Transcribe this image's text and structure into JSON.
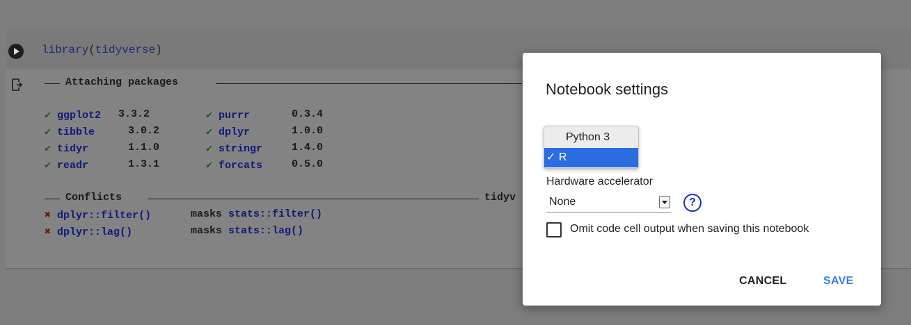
{
  "cell": {
    "code_fn": "library",
    "code_open": "(",
    "code_arg": "tidyverse",
    "code_close": ")"
  },
  "output": {
    "attaching_header": "Attaching packages",
    "packages_left": [
      {
        "check": "✔",
        "name": "ggplot2",
        "version": "3.3.2"
      },
      {
        "check": "✔",
        "name": "tibble",
        "version": "3.0.2"
      },
      {
        "check": "✔",
        "name": "tidyr",
        "version": "1.1.0"
      },
      {
        "check": "✔",
        "name": "readr",
        "version": "1.3.1"
      }
    ],
    "packages_right": [
      {
        "check": "✔",
        "name": "purrr",
        "version": "0.3.4"
      },
      {
        "check": "✔",
        "name": "dplyr",
        "version": "1.0.0"
      },
      {
        "check": "✔",
        "name": "stringr",
        "version": "1.4.0"
      },
      {
        "check": "✔",
        "name": "forcats",
        "version": "0.5.0"
      }
    ],
    "conflicts_header": "Conflicts",
    "conflicts_right": "tidyv",
    "conflicts": [
      {
        "mark": "✖",
        "fn": "dplyr::filter()",
        "masks": "masks",
        "target": "stats::filter()"
      },
      {
        "mark": "✖",
        "fn": "dplyr::lag()",
        "masks": "masks",
        "target": "stats::lag()"
      }
    ]
  },
  "dialog": {
    "title": "Notebook settings",
    "runtime_options": [
      "Python 3",
      "R"
    ],
    "runtime_selected_mark": "✓",
    "hardware_label": "Hardware accelerator",
    "hardware_value": "None",
    "help_icon": "?",
    "omit_label": "Omit code cell output when saving this notebook",
    "cancel_label": "CANCEL",
    "save_label": "SAVE"
  },
  "colors": {
    "accent": "#3a7bf0",
    "selection": "#2a6de0",
    "check_green": "#1f5a13",
    "cross_red": "#7a1010"
  }
}
